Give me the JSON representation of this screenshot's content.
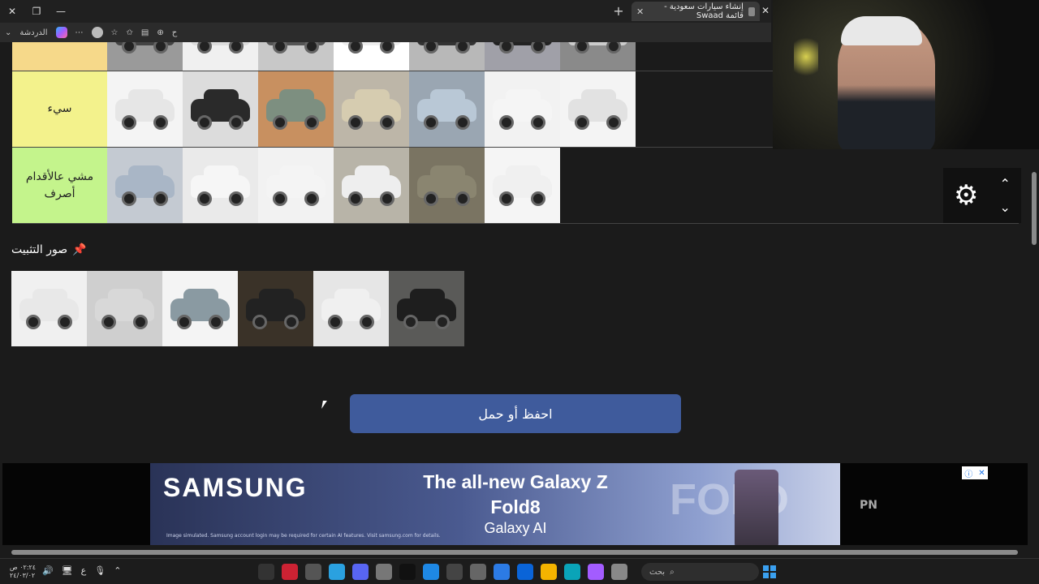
{
  "browser": {
    "tab_title": "إنشاء سيارات سعودية - قائمة Swaad",
    "chat_label": "الدردشة",
    "read_aloud": "ح"
  },
  "tiers": [
    {
      "label": "",
      "color": "#f6d98a"
    },
    {
      "label": "سيء",
      "color": "#f3f28c"
    },
    {
      "label": "مشي عالأقدام أصرف",
      "color": "#c4f48c"
    }
  ],
  "pinned": {
    "title": "صور التثبيت",
    "pin_icon": "📌"
  },
  "save_button": "احفظ أو حمل",
  "controls": {
    "gear": "⚙",
    "up": "⌃",
    "down": "⌄"
  },
  "ad": {
    "brand": "SAMSUNG",
    "headline": "The all-new Galaxy Z Fold8",
    "sub": "Galaxy AI",
    "fold_text": "FOLD",
    "fine_print": "Image simulated. Samsung account login may be required for certain AI features. Visit samsung.com for details.",
    "side": "PN"
  },
  "taskbar": {
    "time": "٠٢:٢٤ ص",
    "date": "٢٤/٠٣/٠٢",
    "lang": "ع",
    "search_placeholder": "بحث"
  }
}
